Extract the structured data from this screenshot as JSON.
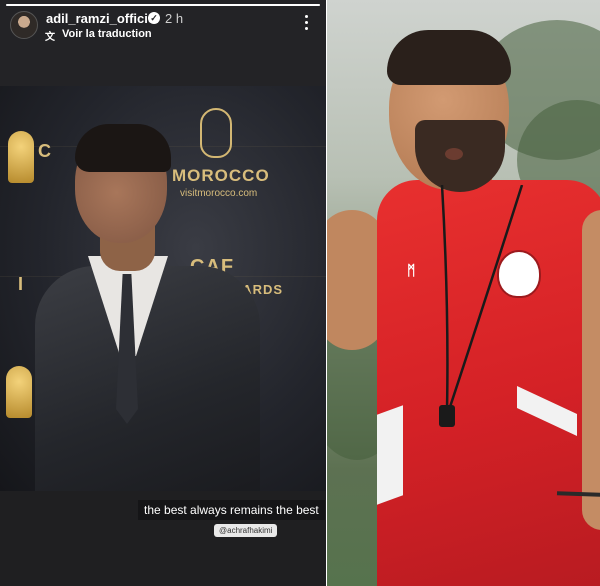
{
  "story": {
    "username": "adil_ramzi_officiel",
    "timestamp": "2 h",
    "translate_label": "Voir la traduction",
    "caption": "the best always remains the best",
    "mention": "@achrafhakimi",
    "progress": 1.0
  },
  "backdrop": {
    "brand_morocco": "MOROCCO",
    "brand_site": "visitmorocco.com",
    "brand_caf": "CAF",
    "brand_awards": "AWARDS",
    "partial_c": "C",
    "partial_i": "I"
  },
  "colors": {
    "gold": "#d8bd7c",
    "jersey_red": "#d42126",
    "story_bg": "#1b1b1d"
  },
  "icons": {
    "verified": "verified-badge",
    "translate": "translate-icon",
    "more": "more-options-icon"
  }
}
